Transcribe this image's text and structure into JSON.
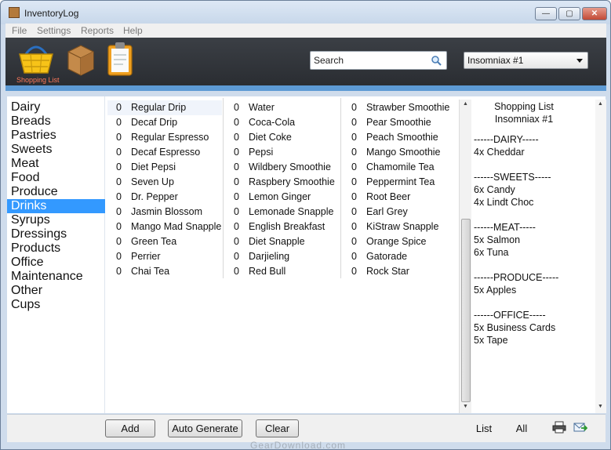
{
  "window": {
    "title": "InventoryLog"
  },
  "menu": [
    "File",
    "Settings",
    "Reports",
    "Help"
  ],
  "toolbar": {
    "shopping_label": "Shopping List",
    "search_placeholder": "Search",
    "selected_list": "Insomniax #1"
  },
  "categories": [
    "Dairy",
    "Breads",
    "Pastries",
    "Sweets",
    "Meat",
    "Food",
    "Produce",
    "Drinks",
    "Syrups",
    "Dressings",
    "Products",
    "Office",
    "Maintenance",
    "Other",
    "Cups"
  ],
  "selected_category": "Drinks",
  "items": {
    "col1": [
      {
        "qty": "0",
        "name": "Regular Drip"
      },
      {
        "qty": "0",
        "name": "Decaf Drip"
      },
      {
        "qty": "0",
        "name": "Regular Espresso"
      },
      {
        "qty": "0",
        "name": "Decaf Espresso"
      },
      {
        "qty": "0",
        "name": "Diet Pepsi"
      },
      {
        "qty": "0",
        "name": "Seven Up"
      },
      {
        "qty": "0",
        "name": "Dr. Pepper"
      },
      {
        "qty": "0",
        "name": "Jasmin Blossom"
      },
      {
        "qty": "0",
        "name": "Mango Mad Snapple"
      },
      {
        "qty": "0",
        "name": "Green Tea"
      },
      {
        "qty": "0",
        "name": "Perrier"
      },
      {
        "qty": "0",
        "name": "Chai Tea"
      }
    ],
    "col2": [
      {
        "qty": "0",
        "name": "Water"
      },
      {
        "qty": "0",
        "name": "Coca-Cola"
      },
      {
        "qty": "0",
        "name": "Diet Coke"
      },
      {
        "qty": "0",
        "name": "Pepsi"
      },
      {
        "qty": "0",
        "name": "Wildbery Smoothie"
      },
      {
        "qty": "0",
        "name": "Raspbery Smoothie"
      },
      {
        "qty": "0",
        "name": "Lemon Ginger"
      },
      {
        "qty": "0",
        "name": "Lemonade Snapple"
      },
      {
        "qty": "0",
        "name": "English Breakfast"
      },
      {
        "qty": "0",
        "name": "Diet Snapple"
      },
      {
        "qty": "0",
        "name": "Darjieling"
      },
      {
        "qty": "0",
        "name": "Red Bull"
      }
    ],
    "col3": [
      {
        "qty": "0",
        "name": "Strawber Smoothie"
      },
      {
        "qty": "0",
        "name": "Pear Smoothie"
      },
      {
        "qty": "0",
        "name": "Peach Smoothie"
      },
      {
        "qty": "0",
        "name": "Mango Smoothie"
      },
      {
        "qty": "0",
        "name": "Chamomile Tea"
      },
      {
        "qty": "0",
        "name": "Peppermint Tea"
      },
      {
        "qty": "0",
        "name": "Root Beer"
      },
      {
        "qty": "0",
        "name": "Earl Grey"
      },
      {
        "qty": "0",
        "name": "KiStraw Snapple"
      },
      {
        "qty": "0",
        "name": "Orange Spice"
      },
      {
        "qty": "0",
        "name": "Gatorade"
      },
      {
        "qty": "0",
        "name": "Rock Star"
      }
    ]
  },
  "shopping_list": {
    "title": "Shopping List",
    "subtitle": "Insomniax #1",
    "lines": [
      "------DAIRY-----",
      "4x Cheddar",
      "",
      "------SWEETS-----",
      "6x Candy",
      "4x Lindt Choc",
      "",
      "------MEAT-----",
      "5x Salmon",
      "6x Tuna",
      "",
      "------PRODUCE-----",
      "5x Apples",
      "",
      "------OFFICE-----",
      "5x Business Cards",
      "5x Tape"
    ]
  },
  "buttons": {
    "add": "Add",
    "auto_generate": "Auto Generate",
    "clear": "Clear",
    "list": "List",
    "all": "All"
  },
  "watermark": "GearDownload.com",
  "colors": {
    "selected": "#3399ff",
    "accent_stripe": "#5d9ad4",
    "toolbar_bg": "#2f3338"
  }
}
